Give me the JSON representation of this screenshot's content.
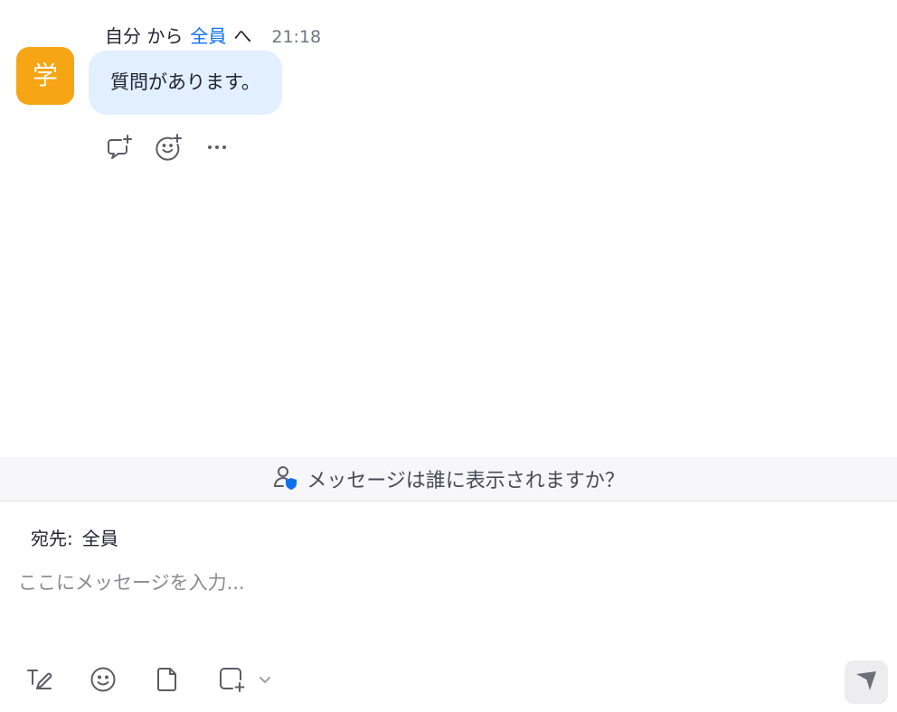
{
  "message": {
    "avatar_initial": "学",
    "sender": "自分 から",
    "recipient": "全員",
    "to_word": "へ",
    "time": "21:18",
    "text": "質問があります。",
    "avatar_color": "#f6a514",
    "bubble_color": "#e1efff"
  },
  "message_actions": {
    "icons": [
      "reply-icon",
      "add-reaction-icon",
      "more-icon"
    ]
  },
  "privacy_banner": {
    "label": "メッセージは誰に表示されますか？",
    "icon": "person-shield-icon"
  },
  "composer": {
    "to_label": "宛先:",
    "to_value": "全員",
    "placeholder": "ここにメッセージを入力...",
    "toolbar_icons": [
      "format-text-icon",
      "emoji-icon",
      "file-icon",
      "screenshot-icon",
      "chevron-down-icon"
    ],
    "send_icon": "send-icon"
  },
  "colors": {
    "accent": "#0e71eb",
    "badge_blue": "#0e71eb"
  }
}
